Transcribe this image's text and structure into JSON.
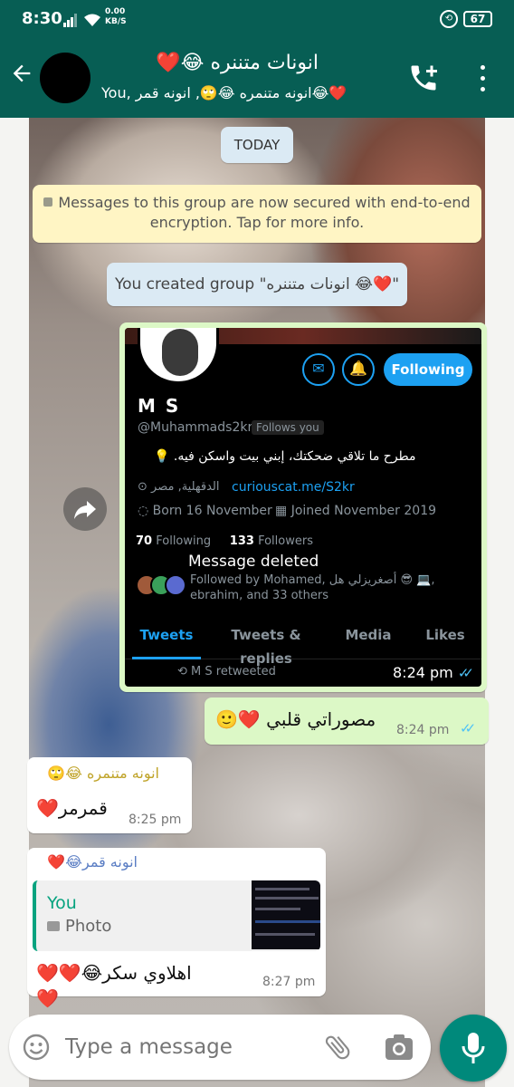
{
  "status_bar": {
    "time": "8:30",
    "net_speed": "0.00",
    "net_unit": "KB/S",
    "battery": "67"
  },
  "header": {
    "back_icon": "arrow-left-icon",
    "group_title": "انونات متننره 😂❤️",
    "members": "You, انونه متنمره 😂🙄, انونه قمر😂❤️",
    "add_call_icon": "add-call-icon",
    "menu_icon": "more-vert-icon"
  },
  "system": {
    "date_chip": "TODAY",
    "encryption_notice": "Messages to this group are now secured with end-to-end encryption. Tap for more info.",
    "created_notice": "You created group \"انونات متننره 😂❤️\""
  },
  "messages": {
    "image_msg": {
      "time": "8:24 pm",
      "forward_icon": "forward-icon",
      "screenshot": {
        "name": "M S",
        "handle": "@Muhammads2kr",
        "follows_you": "Follows you",
        "bio": "مطرح ما تلاقي ضحكتك، إبني بيت واسكن فيه. 💡",
        "location": "الدقهلية, مصر",
        "link": "curiouscat.me/S2kr",
        "born": "Born 16 November",
        "joined": "Joined November 2019",
        "following_count": "70",
        "following_label": "Following",
        "followers_count": "133",
        "followers_label": "Followers",
        "followed_by": "Followed by Mohamed, أصغريزلي هل 😎 💻, ebrahim, and 33 others",
        "deleted_overlay": "Message deleted",
        "follow_button": "Following",
        "tabs": [
          "Tweets",
          "Tweets & replies",
          "Media",
          "Likes"
        ],
        "retweet_line": "M S retweeted"
      }
    },
    "text_msg_out": {
      "text": "مصوراتي قلبي ❤️🙂",
      "time": "8:24 pm"
    },
    "text_msg_in_1": {
      "sender": "انونه متنمره 😂🙄",
      "text": "قمرمر❤️",
      "time": "8:25 pm"
    },
    "text_msg_in_2": {
      "sender": "انونه قمر😂❤️",
      "quote_author": "You",
      "quote_type": "Photo",
      "text": "اهلاوي سكر😂❤️❤️❤️",
      "time": "8:27 pm"
    }
  },
  "input": {
    "placeholder": "Type a message",
    "emoji_icon": "emoji-icon",
    "attach_icon": "paperclip-icon",
    "camera_icon": "camera-icon",
    "mic_icon": "mic-icon"
  },
  "colors": {
    "header": "#075e54",
    "outgoing_bubble": "#dcf8c6",
    "mic_button": "#00897b",
    "read_ticks": "#4fc3f7",
    "twitter_blue": "#1da1f2"
  }
}
